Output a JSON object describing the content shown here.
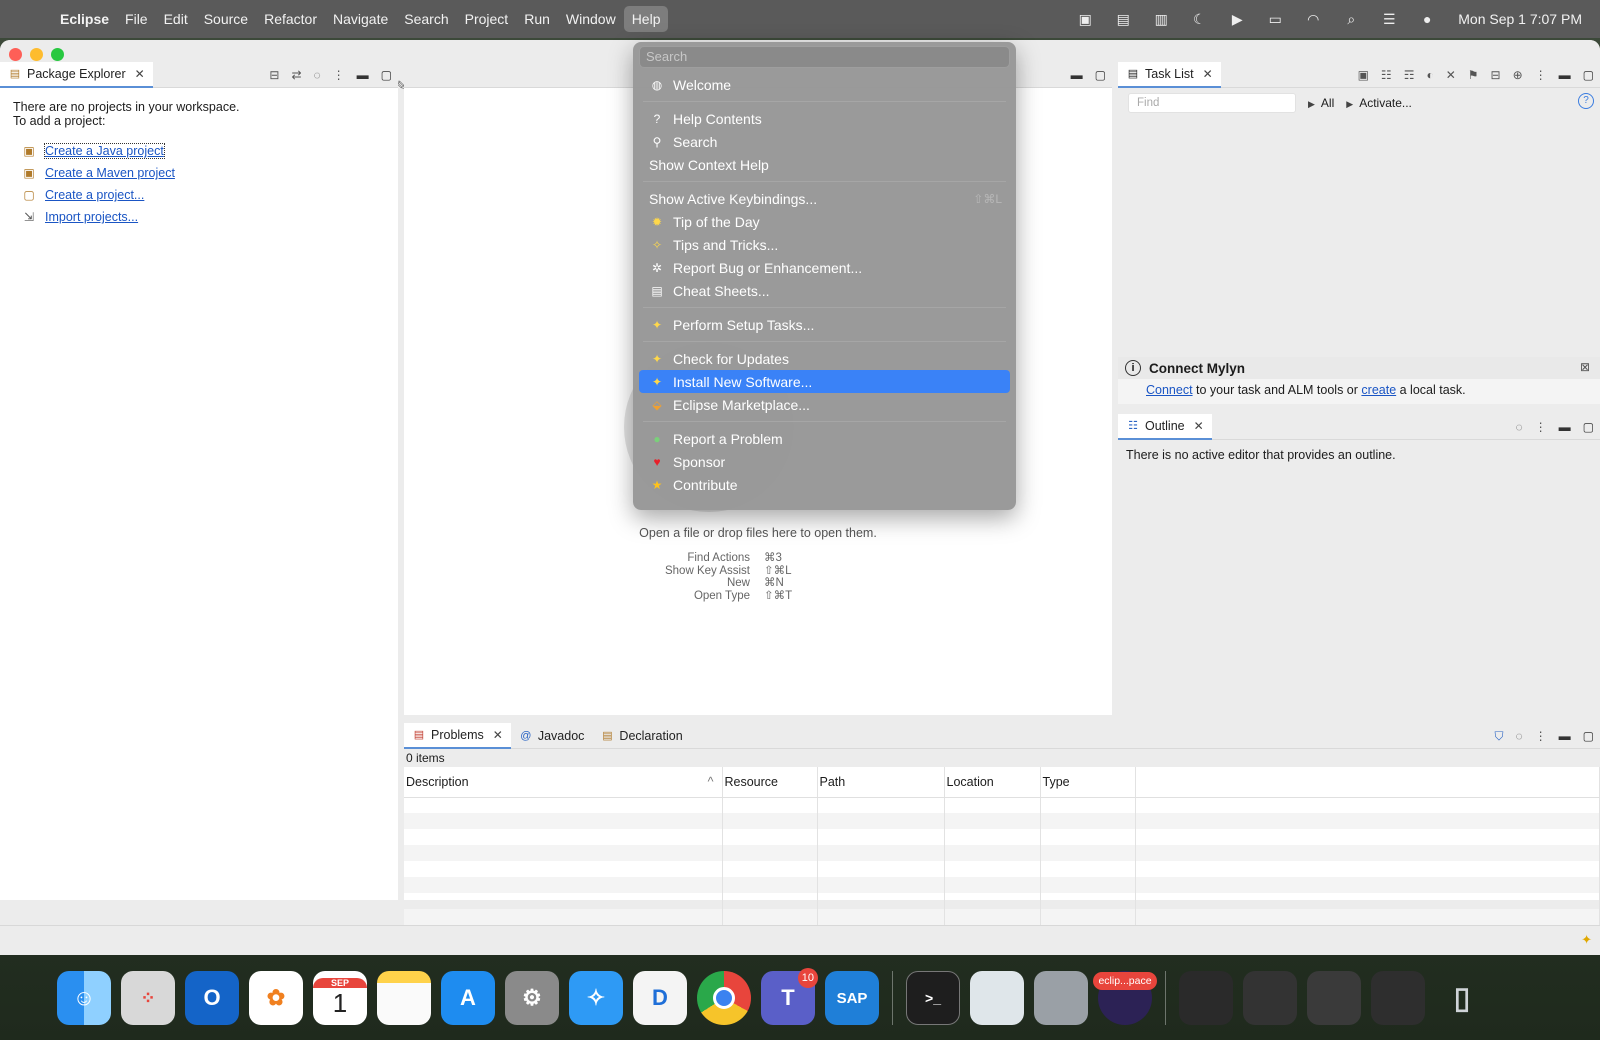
{
  "menubar": {
    "app": "Eclipse",
    "items": [
      "File",
      "Edit",
      "Source",
      "Refactor",
      "Navigate",
      "Search",
      "Project",
      "Run",
      "Window",
      "Help"
    ],
    "active": "Help",
    "clock": "Mon Sep 1  7:07 PM"
  },
  "package_explorer": {
    "tab": "Package Explorer",
    "message_line1": "There are no projects in your workspace.",
    "message_line2": "To add a project:",
    "links": [
      {
        "label": "Create a Java project"
      },
      {
        "label": "Create a Maven project"
      },
      {
        "label": "Create a project..."
      },
      {
        "label": "Import projects..."
      }
    ]
  },
  "editor": {
    "hint": "Open a file or drop files here to open them.",
    "shortcuts": [
      {
        "action": "Find Actions",
        "key": "⌘3"
      },
      {
        "action": "Show Key Assist",
        "key": "⇧⌘L"
      },
      {
        "action": "New",
        "key": "⌘N"
      },
      {
        "action": "Open Type",
        "key": "⇧⌘T"
      }
    ]
  },
  "task_list": {
    "tab": "Task List",
    "find_placeholder": "Find",
    "all_label": "All",
    "activate_label": "Activate..."
  },
  "mylyn": {
    "title": "Connect Mylyn",
    "connect": "Connect",
    "middle": " to your task and ALM tools or ",
    "create": "create",
    "end": " a local task."
  },
  "outline": {
    "tab": "Outline",
    "message": "There is no active editor that provides an outline."
  },
  "problems": {
    "tabs": [
      "Problems",
      "Javadoc",
      "Declaration"
    ],
    "count": "0 items",
    "columns": [
      "Description",
      "Resource",
      "Path",
      "Location",
      "Type"
    ]
  },
  "help_menu": {
    "search_placeholder": "Search",
    "items": [
      {
        "label": "Welcome",
        "icon": "globe-icon"
      },
      {
        "label": "Help Contents",
        "icon": "question-icon"
      },
      {
        "label": "Search",
        "icon": "search-people-icon"
      },
      {
        "label": "Show Context Help",
        "icon": ""
      },
      {
        "label": "Show Active Keybindings...",
        "shortcut": "⇧⌘L"
      },
      {
        "label": "Tip of the Day",
        "icon": "lightbulb-icon"
      },
      {
        "label": "Tips and Tricks...",
        "icon": "wand-icon"
      },
      {
        "label": "Report Bug or Enhancement...",
        "icon": "bug-icon"
      },
      {
        "label": "Cheat Sheets...",
        "icon": "cheatsheet-icon"
      },
      {
        "label": "Perform Setup Tasks...",
        "icon": "setup-icon"
      },
      {
        "label": "Check for Updates",
        "icon": "update-icon"
      },
      {
        "label": "Install New Software...",
        "icon": "install-icon"
      },
      {
        "label": "Eclipse Marketplace...",
        "icon": "marketplace-icon"
      },
      {
        "label": "Report a Problem",
        "icon": "problem-icon"
      },
      {
        "label": "Sponsor",
        "icon": "heart-icon"
      },
      {
        "label": "Contribute",
        "icon": "star-icon"
      }
    ],
    "highlighted": "Install New Software..."
  },
  "dock": {
    "calendar_month": "SEP",
    "calendar_day": "1",
    "teams_badge": "10",
    "sap_label": "SAP",
    "eclipse_label": "eclip...pace"
  },
  "colors": {
    "accent": "#3a82f7",
    "link": "#1a55c4",
    "menu_bg": "#969696"
  }
}
